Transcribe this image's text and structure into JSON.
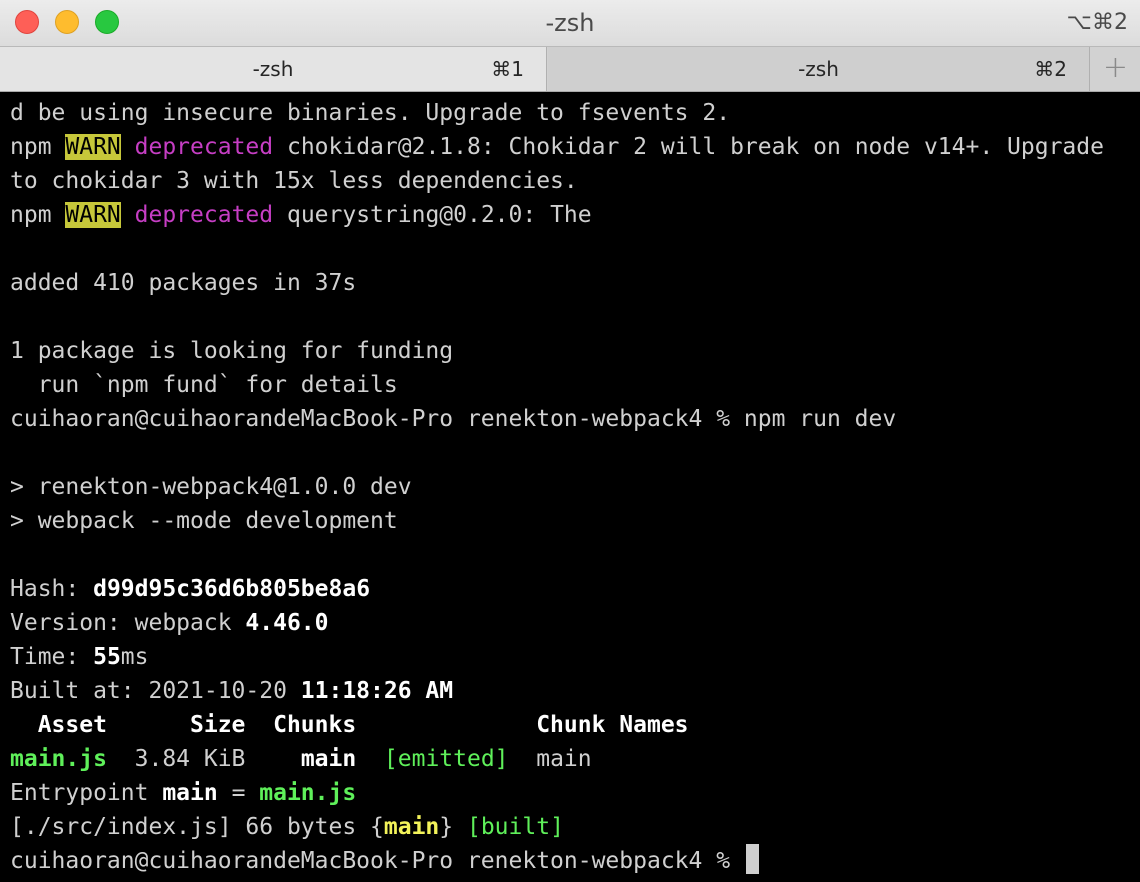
{
  "window": {
    "title": "-zsh",
    "shortcut": "⌥⌘2"
  },
  "tabs": [
    {
      "label": "-zsh",
      "key": "⌘1"
    },
    {
      "label": "-zsh",
      "key": "⌘2"
    }
  ],
  "tab_add": "+",
  "colors": {
    "warn_bg": "#c6c73a",
    "deprecated": "#c63ec4",
    "green": "#5ff05a",
    "yellow": "#f3f35a"
  },
  "terminal": {
    "l1": "d be using insecure binaries. Upgrade to fsevents 2.",
    "npm": "npm ",
    "warn": "WARN",
    "deprecated": "deprecated",
    "l2_rest": " chokidar@2.1.8: Chokidar 2 will break on node v14+. Upgrade",
    "l3": "to chokidar 3 with 15x less dependencies.",
    "l4_rest": " querystring@0.2.0: The",
    "l6": "added 410 packages in 37s",
    "l8": "1 package is looking for funding",
    "l9": "  run `npm fund` for details",
    "prompt": "cuihaoran@cuihaorandeMacBook-Pro renekton-webpack4 % ",
    "cmd": "npm run dev",
    "l12": "> renekton-webpack4@1.0.0 dev",
    "l13": "> webpack --mode development",
    "hash_label": "Hash: ",
    "hash": "d99d95c36d6b805be8a6",
    "version_label": "Version: webpack ",
    "version": "4.46.0",
    "time_label": "Time: ",
    "time_val": "55",
    "time_unit": "ms",
    "built_label": "Built at: 2021-10-20 ",
    "built_time": "11:18:26 AM",
    "table_header": "  Asset      Size  Chunks             Chunk Names",
    "asset_name": "main.js",
    "asset_size": "  3.84 KiB    ",
    "asset_chunk": "main",
    "asset_sp": "  ",
    "emitted": "[emitted]",
    "asset_chunkname": "  main",
    "entry_label": "Entrypoint ",
    "entry_name": "main",
    "entry_eq": " = ",
    "entry_file": "main.js",
    "mod_path": "[./src/index.js]",
    "mod_size": " 66 bytes {",
    "mod_chunk": "main",
    "mod_close": "} ",
    "built_tag": "[built]"
  }
}
